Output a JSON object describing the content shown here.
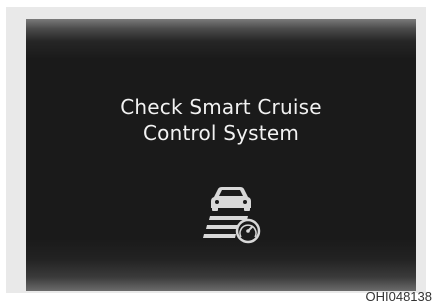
{
  "display": {
    "message_line1": "Check Smart Cruise",
    "message_line2": "Control System",
    "icon": "smart-cruise-control-icon"
  },
  "caption": "OHI048138",
  "colors": {
    "screen_background": "#1a1a1a",
    "text": "#f2f2f2",
    "icon": "#d8d8d8"
  }
}
